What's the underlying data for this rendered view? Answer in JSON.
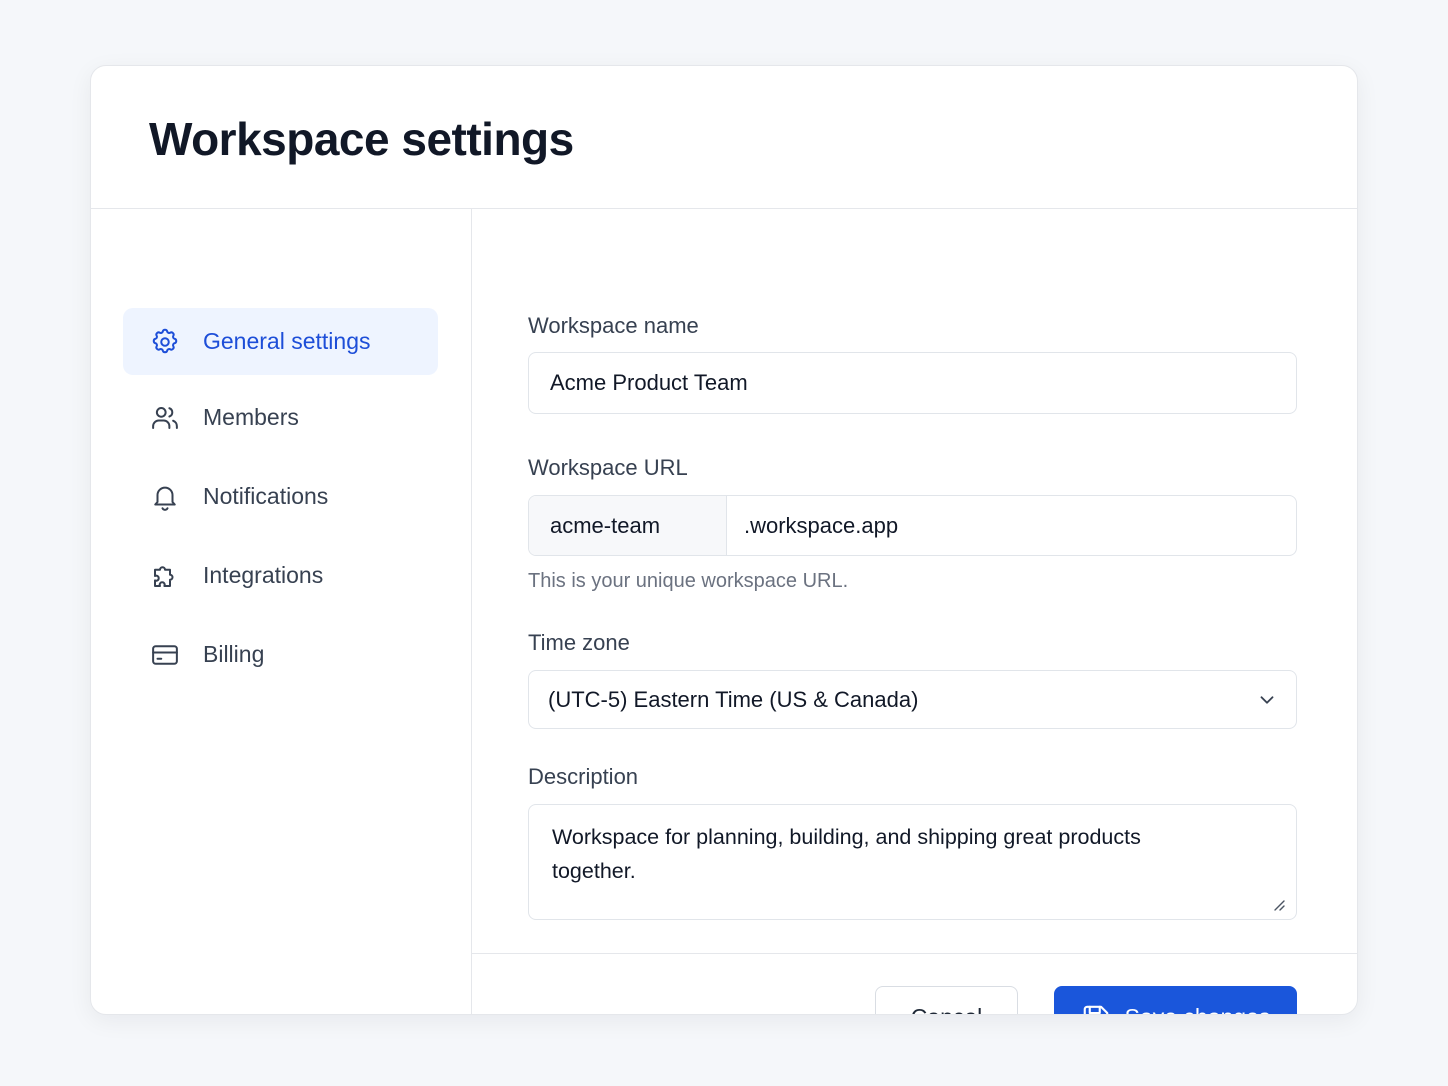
{
  "page": {
    "title": "Workspace settings"
  },
  "sidebar": {
    "items": [
      {
        "label": "General settings",
        "icon": "gear-icon",
        "active": true
      },
      {
        "label": "Members",
        "icon": "users-icon"
      },
      {
        "label": "Notifications",
        "icon": "bell-icon"
      },
      {
        "label": "Integrations",
        "icon": "puzzle-icon"
      },
      {
        "label": "Billing",
        "icon": "credit-card-icon"
      }
    ]
  },
  "form": {
    "name": {
      "label": "Workspace name",
      "value": "Acme Product Team"
    },
    "url": {
      "label": "Workspace URL",
      "prefix": "acme-team",
      "suffix": ".workspace.app",
      "helper": "This is your unique workspace URL."
    },
    "timezone": {
      "label": "Time zone",
      "value": "(UTC-5) Eastern Time (US & Canada)"
    },
    "description": {
      "label": "Description",
      "value": "Workspace for planning, building, and shipping great products together."
    }
  },
  "actions": {
    "cancel": "Cancel",
    "save": "Save changes"
  },
  "colors": {
    "accent": "#1a56db",
    "active_bg": "#eef4ff",
    "active_text": "#1d4ed8"
  }
}
